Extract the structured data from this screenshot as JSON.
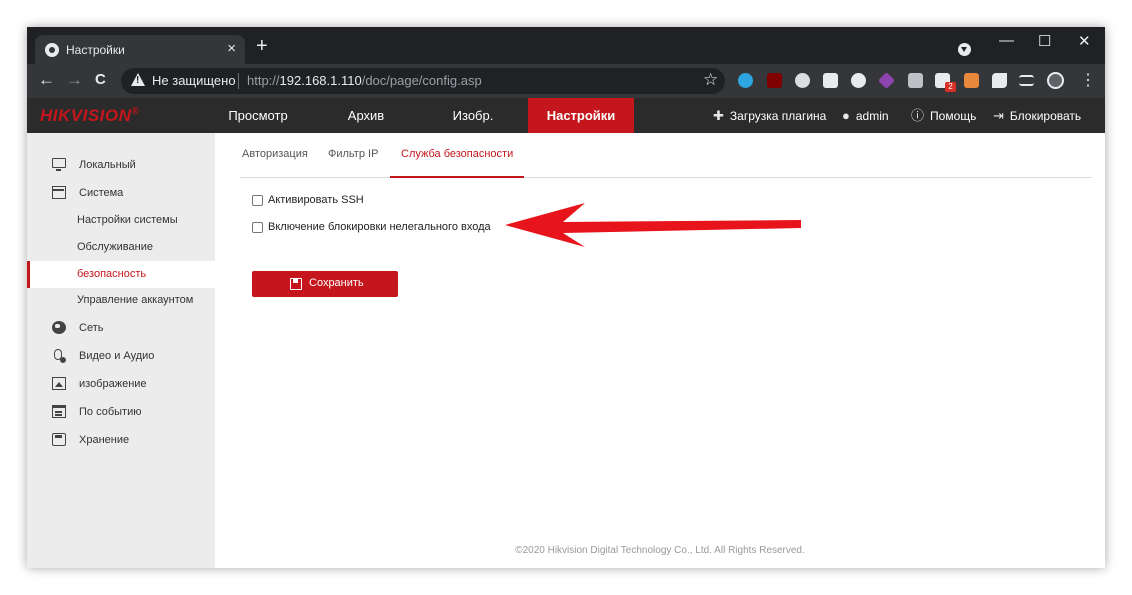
{
  "browser": {
    "tab_title": "Настройки",
    "tab_close": "×",
    "new_tab": "+",
    "window_controls": {
      "minimize": "—",
      "maximize": "☐",
      "close": "✕"
    },
    "nav": {
      "back": "←",
      "forward": "→",
      "reload": "C"
    },
    "security_label": "Не защищено",
    "url_prefix": "http://",
    "url_host": "192.168.1.110",
    "url_path": "/doc/page/config.asp",
    "star": "☆",
    "menu": "⋮",
    "ext_badge": "2"
  },
  "app": {
    "logo": "HIKVISION",
    "logo_reg": "®",
    "nav": [
      "Просмотр",
      "Архив",
      "Изобр.",
      "Настройки"
    ],
    "active_nav_index": 3,
    "header_tools": {
      "plugin": "Загрузка плагина",
      "user": "admin",
      "help": "Помощь",
      "lock": "Блокировать"
    }
  },
  "sidebar": {
    "items": [
      {
        "label": "Локальный",
        "icon": "monitor-icon"
      },
      {
        "label": "Система",
        "icon": "window-icon"
      },
      {
        "label": "Настройки системы",
        "sub": true
      },
      {
        "label": "Обслуживание",
        "sub": true
      },
      {
        "label": "безопасность",
        "sub": true,
        "active": true
      },
      {
        "label": "Управление аккаунтом",
        "sub": true
      },
      {
        "label": "Сеть",
        "icon": "globe-icon"
      },
      {
        "label": "Видео и Аудио",
        "icon": "microphone-icon"
      },
      {
        "label": "изображение",
        "icon": "image-icon"
      },
      {
        "label": "По событию",
        "icon": "calendar-icon"
      },
      {
        "label": "Хранение",
        "icon": "disk-icon"
      }
    ]
  },
  "main": {
    "tabs": [
      "Авторизация",
      "Фильтр IP",
      "Служба безопасности"
    ],
    "active_tab_index": 2,
    "options": [
      {
        "label": "Активировать SSH",
        "checked": false
      },
      {
        "label": "Включение блокировки нелегального входа",
        "checked": false
      }
    ],
    "save_label": "Сохранить",
    "footer": "©2020 Hikvision Digital Technology Co., Ltd. All Rights Reserved."
  },
  "colors": {
    "accent": "#c4161c",
    "header_bg": "#2b2b2b",
    "sidebar_bg": "#ececec",
    "annotation_arrow": "#e8141b"
  }
}
